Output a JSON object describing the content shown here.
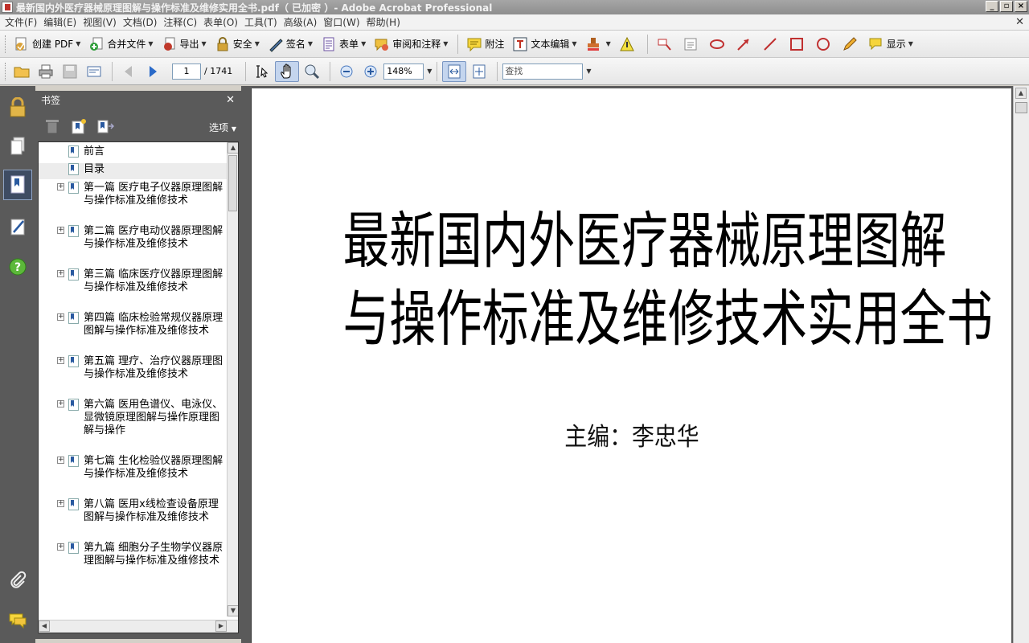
{
  "window": {
    "title": "最新国内外医疗器械原理图解与操作标准及维修实用全书.pdf（ 已加密 ）- Adobe Acrobat Professional"
  },
  "menubar": {
    "items": [
      "文件(F)",
      "编辑(E)",
      "视图(V)",
      "文档(D)",
      "注释(C)",
      "表单(O)",
      "工具(T)",
      "高级(A)",
      "窗口(W)",
      "帮助(H)"
    ]
  },
  "toolbar1": {
    "create_pdf": "创建 PDF",
    "combine": "合并文件",
    "export": "导出",
    "security": "安全",
    "sign": "签名",
    "forms": "表单",
    "review": "审阅和注释",
    "note": "附注",
    "text_edit": "文本编辑",
    "show": "显示"
  },
  "toolbar2": {
    "page_current": "1",
    "page_total": "/ 1741",
    "zoom": "148%",
    "search_placeholder": "查找"
  },
  "bookmarks": {
    "title": "书签",
    "options": "选项",
    "items": [
      {
        "text": "前言",
        "expandable": false
      },
      {
        "text": "目录",
        "expandable": false,
        "selected": true
      },
      {
        "text": "第一篇 医疗电子仪器原理图解与操作标准及维修技术",
        "expandable": true
      },
      {
        "text": "第二篇 医疗电动仪器原理图解与操作标准及维修技术",
        "expandable": true
      },
      {
        "text": "第三篇 临床医疗仪器原理图解与操作标准及维修技术",
        "expandable": true
      },
      {
        "text": "第四篇 临床检验常规仪器原理图解与操作标准及维修技术",
        "expandable": true
      },
      {
        "text": "第五篇 理疗、治疗仪器原理图与操作标准及维修技术",
        "expandable": true
      },
      {
        "text": "第六篇 医用色谱仪、电泳仪、显微镜原理图解与操作原理图解与操作",
        "expandable": true
      },
      {
        "text": "第七篇 生化检验仪器原理图解与操作标准及维修技术",
        "expandable": true
      },
      {
        "text": "第八篇 医用x线检查设备原理图解与操作标准及维修技术",
        "expandable": true
      },
      {
        "text": "第九篇 细胞分子生物学仪器原理图解与操作标准及维修技术",
        "expandable": true
      }
    ]
  },
  "document": {
    "title_line1": "最新国内外医疗器械原理图解",
    "title_line2": "与操作标准及维修技术实用全书",
    "editor": "主编：李忠华"
  }
}
